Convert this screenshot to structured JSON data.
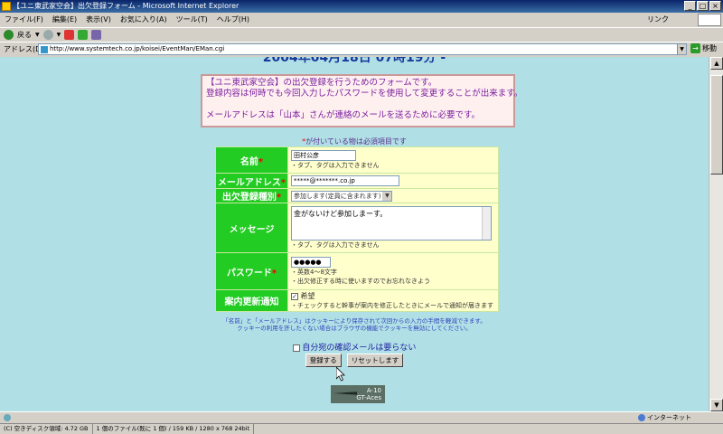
{
  "window": {
    "title": "【ユニ東武家空会】出欠登録フォーム - Microsoft Internet Explorer",
    "buttons": {
      "minimize": "_",
      "maximize": "□",
      "close": "×"
    }
  },
  "menubar": {
    "items": [
      "ファイル(F)",
      "編集(E)",
      "表示(V)",
      "お気に入り(A)",
      "ツール(T)",
      "ヘルプ(H)"
    ],
    "link_label": "リンク"
  },
  "toolbar": {
    "back_label": "戻る"
  },
  "addressbar": {
    "label": "アドレス(D)",
    "url": "http://www.systemtech.co.jp/koisei/EventMan/EMan.cgi",
    "go_label": "移動"
  },
  "page": {
    "heading": "2004年04月18日 07時19分 -",
    "info_lines": [
      "【ユニ東武家空会】の出欠登録を行うためのフォームです。",
      "登録内容は何時でも今回入力したパスワードを使用して変更することが出来ます。",
      "",
      "メールアドレスは「山本」さんが連絡のメールを送るために必要です。"
    ],
    "required_note_star": "*",
    "required_note": "が付いている物は必須項目です"
  },
  "form": {
    "required_mark": "*",
    "name": {
      "label": "名前",
      "value": "田村公彦",
      "note": "・タブ、タグは入力できません"
    },
    "email": {
      "label": "メールアドレス",
      "value": "*****@*******.co.jp"
    },
    "attendance": {
      "label": "出欠登録種別",
      "value": "参加します(定員に含まれます)"
    },
    "message": {
      "label": "メッセージ",
      "value": "金がないけど参加しまーす。",
      "note": "・タブ、タグは入力できません"
    },
    "password": {
      "label": "パスワード",
      "value": "●●●●●",
      "notes": [
        "・英数4～8文字",
        "・出欠修正する時に使いますのでお忘れなきよう"
      ]
    },
    "notify": {
      "label": "案内更新通知",
      "checkbox_label": "希望",
      "checked": true,
      "note": "・チェックすると幹事が案内を修正したときにメールで通知が届きます"
    }
  },
  "cookie_note": [
    "「名前」と「メールアドレス」はクッキーにより保存されて次回からの入力の手間を軽減できます。",
    "クッキーの利用を許したくない場合はブラウザの機能でクッキーを無効にしてください。"
  ],
  "confirm_mail_label": "自分宛の確認メールは要らない",
  "buttons": {
    "submit": "登録する",
    "reset": "リセットします"
  },
  "banner": {
    "line1": "A-10",
    "line2": "GT-Aces"
  },
  "ie_status": {
    "left": "",
    "zone": "インターネット"
  },
  "explorer_status": {
    "disk": "(C) 空きディスク領域: 4.72 GB",
    "file": "1 個のファイル(既に 1 個) / 159 KB / 1280 x 768 24bit"
  }
}
